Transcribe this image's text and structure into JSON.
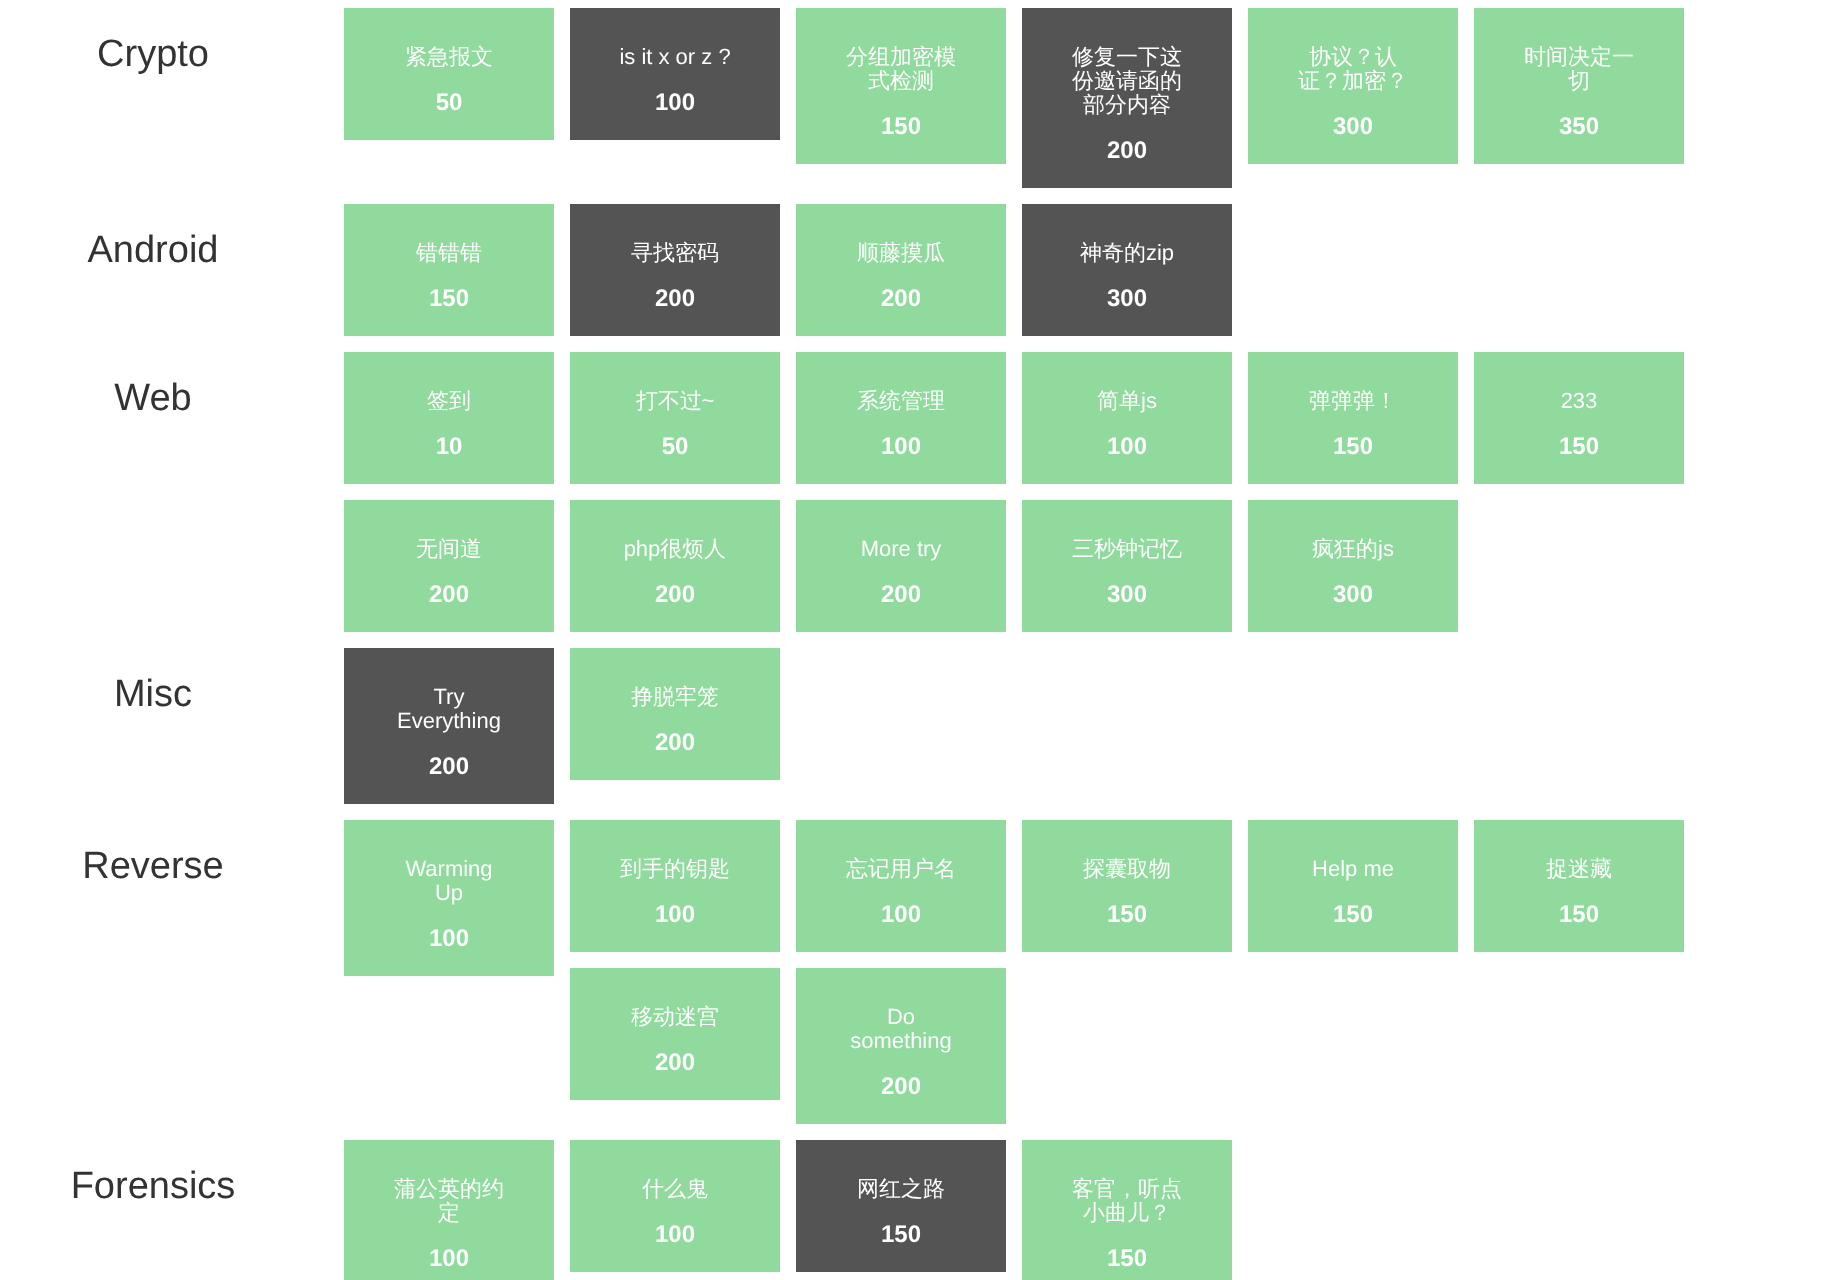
{
  "categories": [
    {
      "name": "Crypto",
      "challenges": [
        {
          "title": "紧急报文",
          "points": "50",
          "solved": false
        },
        {
          "title": "is it x or z ?",
          "points": "100",
          "solved": true
        },
        {
          "title": "分组加密模式检测",
          "points": "150",
          "solved": false
        },
        {
          "title": "修复一下这份邀请函的部分内容",
          "points": "200",
          "solved": true
        },
        {
          "title": "协议？认证？加密？",
          "points": "300",
          "solved": false
        },
        {
          "title": "时间决定一切",
          "points": "350",
          "solved": false
        }
      ]
    },
    {
      "name": "Android",
      "challenges": [
        {
          "title": "错错错",
          "points": "150",
          "solved": false
        },
        {
          "title": "寻找密码",
          "points": "200",
          "solved": true
        },
        {
          "title": "顺藤摸瓜",
          "points": "200",
          "solved": false
        },
        {
          "title": "神奇的zip",
          "points": "300",
          "solved": true
        }
      ]
    },
    {
      "name": "Web",
      "challenges": [
        {
          "title": "签到",
          "points": "10",
          "solved": false
        },
        {
          "title": "打不过~",
          "points": "50",
          "solved": false
        },
        {
          "title": "系统管理",
          "points": "100",
          "solved": false
        },
        {
          "title": "简单js",
          "points": "100",
          "solved": false
        },
        {
          "title": "弹弹弹！",
          "points": "150",
          "solved": false
        },
        {
          "title": "233",
          "points": "150",
          "solved": false
        },
        {
          "title": "无间道",
          "points": "200",
          "solved": false
        },
        {
          "title": "php很烦人",
          "points": "200",
          "solved": false
        },
        {
          "title": "More try",
          "points": "200",
          "solved": false
        },
        {
          "title": "三秒钟记忆",
          "points": "300",
          "solved": false
        },
        {
          "title": "疯狂的js",
          "points": "300",
          "solved": false
        }
      ]
    },
    {
      "name": "Misc",
      "challenges": [
        {
          "title": "Try Everything",
          "points": "200",
          "solved": true
        },
        {
          "title": "挣脱牢笼",
          "points": "200",
          "solved": false
        }
      ]
    },
    {
      "name": "Reverse",
      "challenges": [
        {
          "title": "Warming Up",
          "points": "100",
          "solved": false
        },
        {
          "title": "到手的钥匙",
          "points": "100",
          "solved": false
        },
        {
          "title": "忘记用户名",
          "points": "100",
          "solved": false
        },
        {
          "title": "探囊取物",
          "points": "150",
          "solved": false
        },
        {
          "title": "Help me",
          "points": "150",
          "solved": false
        },
        {
          "title": "捉迷藏",
          "points": "150",
          "solved": false
        },
        {
          "title": "移动迷宫",
          "points": "200",
          "solved": false
        },
        {
          "title": "Do something",
          "points": "200",
          "solved": false
        }
      ]
    },
    {
      "name": "Forensics",
      "challenges": [
        {
          "title": "蒲公英的约定",
          "points": "100",
          "solved": false
        },
        {
          "title": "什么鬼",
          "points": "100",
          "solved": false
        },
        {
          "title": "网红之路",
          "points": "150",
          "solved": true
        },
        {
          "title": "客官，听点小曲儿？",
          "points": "150",
          "solved": false
        }
      ]
    }
  ]
}
